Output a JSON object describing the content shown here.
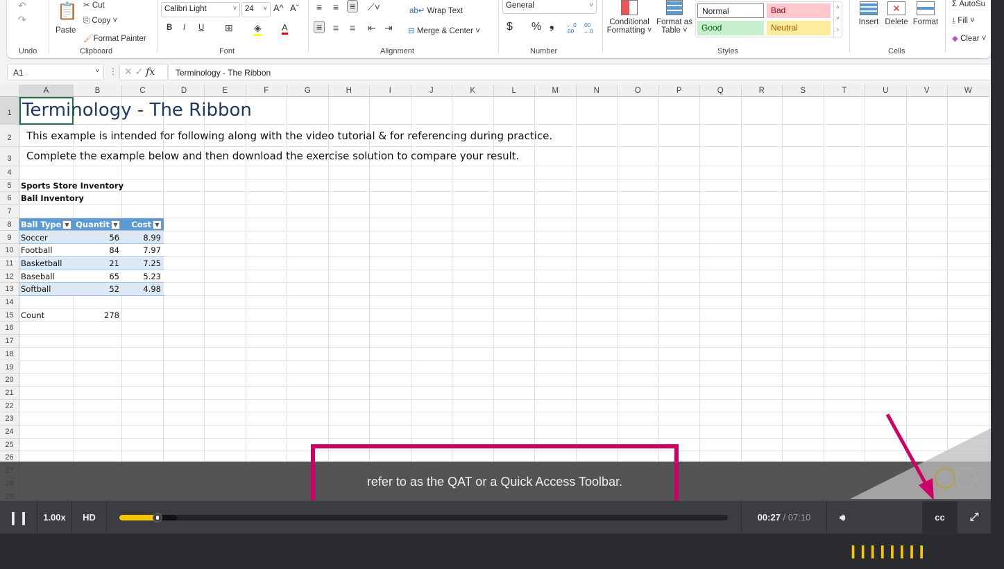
{
  "ribbon": {
    "undo": {
      "label": "Undo"
    },
    "clipboard": {
      "label": "Clipboard",
      "paste": "Paste",
      "cut": "Cut",
      "copy": "Copy",
      "format_painter": "Format Painter"
    },
    "font": {
      "label": "Font",
      "font_name": "Calibri Light",
      "font_size": "24",
      "bold": "B",
      "italic": "I",
      "underline": "U",
      "grow": "A^",
      "shrink": "Aˇ",
      "font_color": "A"
    },
    "alignment": {
      "label": "Alignment",
      "wrap_text": "Wrap Text",
      "merge_center": "Merge & Center"
    },
    "number": {
      "label": "Number",
      "format": "General",
      "currency": "$",
      "percent": "%",
      "comma": "❟",
      "inc_decimal": "←.0 .00",
      "dec_decimal": ".00 →.0"
    },
    "styles": {
      "label": "Styles",
      "conditional_formatting": [
        "Conditional",
        "Formatting ˅"
      ],
      "format_as_table": [
        "Format as",
        "Table ˅"
      ],
      "cells": [
        {
          "name": "Normal",
          "bg": "#ffffff",
          "fg": "#222222"
        },
        {
          "name": "Bad",
          "bg": "#ffc7ce",
          "fg": "#9c0006"
        },
        {
          "name": "Good",
          "bg": "#c6efce",
          "fg": "#006100"
        },
        {
          "name": "Neutral",
          "bg": "#ffeb9c",
          "fg": "#9c5700"
        }
      ]
    },
    "cells": {
      "label": "Cells",
      "insert": "Insert",
      "delete": "Delete",
      "format": "Format"
    },
    "editing": {
      "autosum": "AutoSu",
      "fill": "Fill ˅",
      "clear": "Clear ˅"
    }
  },
  "formula_bar": {
    "name_box": "A1",
    "fx": "fx",
    "formula": "Terminology - The Ribbon"
  },
  "columns": [
    "A",
    "B",
    "C",
    "D",
    "E",
    "F",
    "G",
    "H",
    "I",
    "J",
    "K",
    "L",
    "M",
    "N",
    "O",
    "P",
    "Q",
    "R",
    "S",
    "T",
    "U",
    "V",
    "W"
  ],
  "rows": [
    "1",
    "2",
    "3",
    "4",
    "5",
    "6",
    "7",
    "8",
    "9",
    "10",
    "11",
    "12",
    "13",
    "14",
    "15",
    "16",
    "17",
    "18",
    "19",
    "20",
    "21",
    "22",
    "23",
    "24",
    "25",
    "26",
    "27",
    "28",
    "29"
  ],
  "sheet": {
    "title": "Terminology - The Ribbon",
    "line2": "This example is intended for following along with the video tutorial & for referencing during practice.",
    "line3": "Complete the example below and then download the exercise solution to compare your result.",
    "heading1": "Sports Store Inventory",
    "heading2": "Ball Inventory",
    "table": {
      "headers": [
        "Ball Type",
        "Quantit",
        "Cost"
      ],
      "rows": [
        [
          "Soccer",
          "56",
          "8.99"
        ],
        [
          "Football",
          "84",
          "7.97"
        ],
        [
          "Basketball",
          "21",
          "7.25"
        ],
        [
          "Baseball",
          "65",
          "5.23"
        ],
        [
          "Softball",
          "52",
          "4.98"
        ]
      ],
      "header_color": "#5b9bd5",
      "band_color": "#dde9f5"
    },
    "count_label": "Count",
    "count_value": "278"
  },
  "player": {
    "caption": "refer to as the QAT or a Quick Access Toolbar.",
    "speed": "1.00x",
    "quality": "HD",
    "current_time": "00:27",
    "duration": "07:10",
    "progress_percent": 6.3,
    "buffered_percent": 9.5,
    "cc": "cc",
    "accent": "#f6c600",
    "highlight_color": "#cc0066"
  }
}
